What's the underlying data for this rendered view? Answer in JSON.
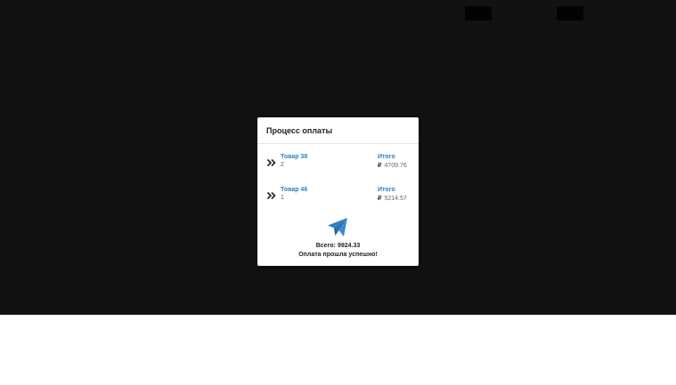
{
  "modal": {
    "title": "Процесс оплаты",
    "items": [
      {
        "name": "Товар 38",
        "qty": "2",
        "total_label": "Итого",
        "currency": "₽",
        "total": "4709.76"
      },
      {
        "name": "Товар 46",
        "qty": "1",
        "total_label": "Итого",
        "currency": "₽",
        "total": "5214.57"
      }
    ],
    "total_text": "Всего: 9924.33",
    "success_text": "Оплата прошла успешно!"
  },
  "colors": {
    "accent": "#2f7fc3",
    "overlay": "#000000"
  },
  "icons": {
    "item": "chevron-double-right-icon",
    "status": "paper-plane-icon"
  }
}
